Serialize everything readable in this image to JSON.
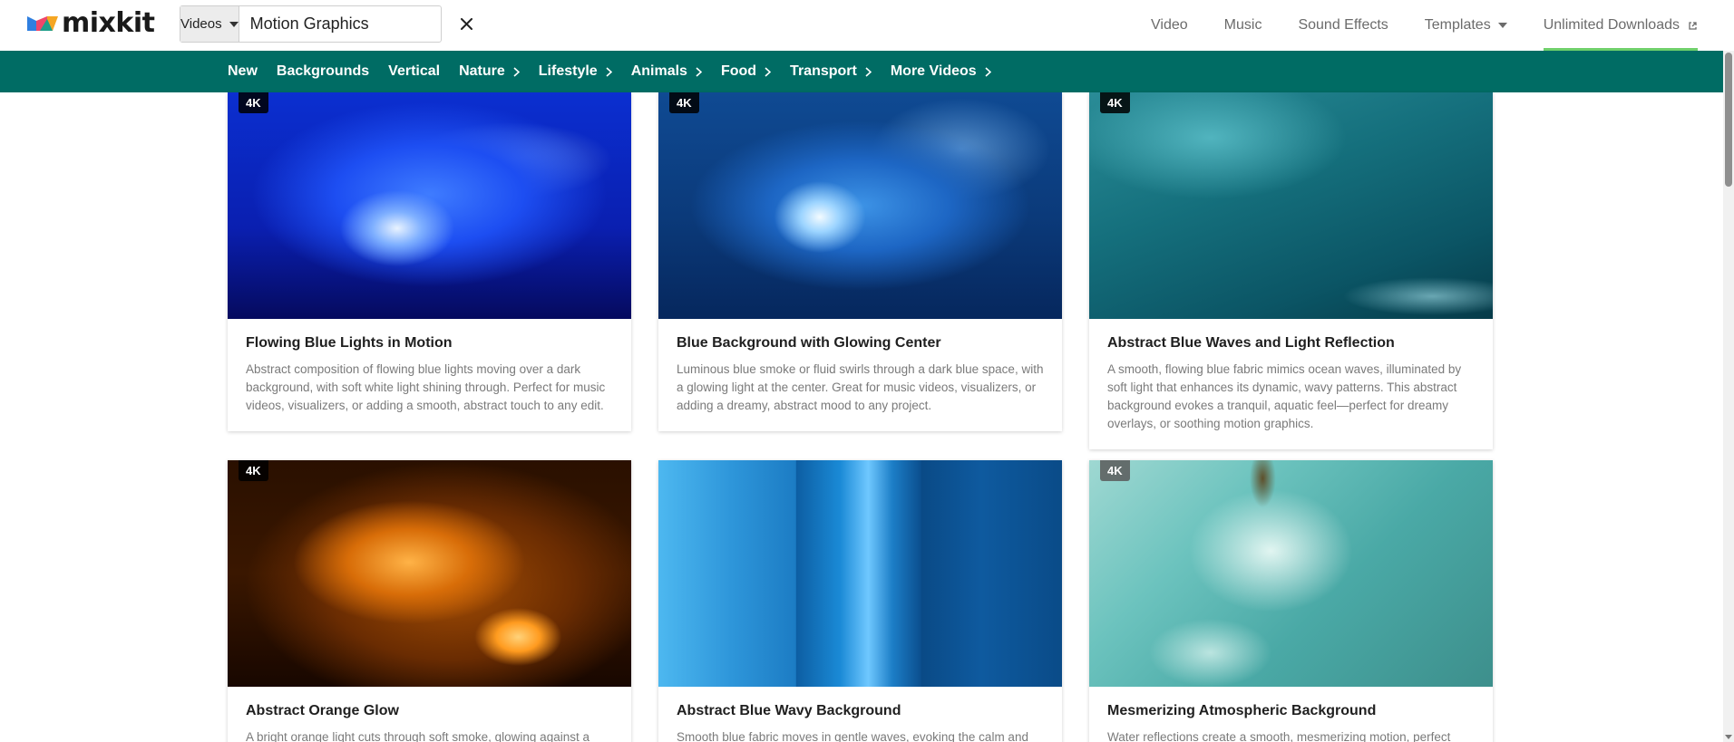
{
  "brand": {
    "name": "mixkit",
    "colors": {
      "teal": "#006c64",
      "active_underline": "#6fd06b"
    }
  },
  "search": {
    "type": "Videos",
    "query": "Motion Graphics",
    "clear_icon": "close-icon"
  },
  "topnav": [
    {
      "label": "Video"
    },
    {
      "label": "Music"
    },
    {
      "label": "Sound Effects"
    },
    {
      "label": "Templates",
      "icon": "chevron-down-icon"
    },
    {
      "label": "Unlimited Downloads",
      "icon": "external-link-icon",
      "active": true
    }
  ],
  "catnav": [
    {
      "label": "New"
    },
    {
      "label": "Backgrounds"
    },
    {
      "label": "Vertical"
    },
    {
      "label": "Nature",
      "icon": "chevron-right-icon"
    },
    {
      "label": "Lifestyle",
      "icon": "chevron-right-icon"
    },
    {
      "label": "Animals",
      "icon": "chevron-right-icon"
    },
    {
      "label": "Food",
      "icon": "chevron-right-icon"
    },
    {
      "label": "Transport",
      "icon": "chevron-right-icon"
    },
    {
      "label": "More Videos",
      "icon": "chevron-right-icon"
    }
  ],
  "cards": [
    {
      "badge": "4K",
      "title": "Flowing Blue Lights in Motion",
      "description": "Abstract composition of flowing blue lights moving over a dark background, with soft white light shining through. Perfect for music videos, visualizers, or adding a smooth, abstract touch to any edit."
    },
    {
      "badge": "4K",
      "title": "Blue Background with Glowing Center",
      "description": "Luminous blue smoke or fluid swirls through a dark blue space, with a glowing light at the center. Great for music videos, visualizers, or adding a dreamy, abstract mood to any project."
    },
    {
      "badge": "4K",
      "title": "Abstract Blue Waves and Light Reflection",
      "description": "A smooth, flowing blue fabric mimics ocean waves, illuminated by soft light that enhances its dynamic, wavy patterns. This abstract background evokes a tranquil, aquatic feel—perfect for dreamy overlays, or soothing motion graphics."
    },
    {
      "badge": "4K",
      "title": "Abstract Orange Glow",
      "description": "A bright orange light cuts through soft smoke, glowing against a"
    },
    {
      "badge": "",
      "title": "Abstract Blue Wavy Background",
      "description": "Smooth blue fabric moves in gentle waves, evoking the calm and"
    },
    {
      "badge": "4K",
      "title": "Mesmerizing Atmospheric Background",
      "description": "Water reflections create a smooth, mesmerizing motion, perfect"
    }
  ]
}
